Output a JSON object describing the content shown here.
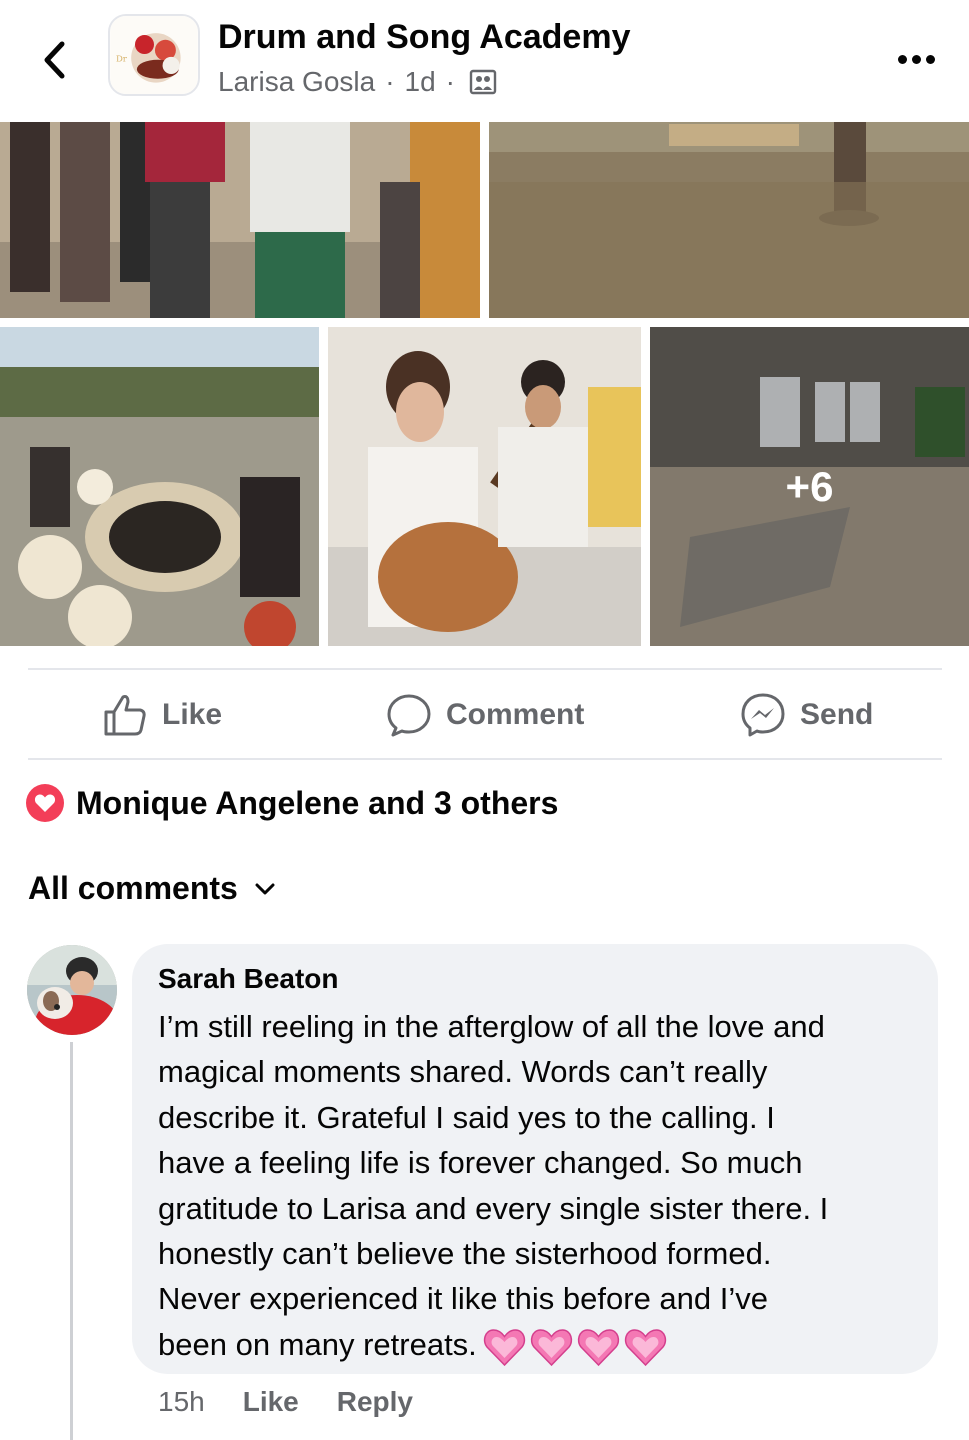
{
  "header": {
    "page_name": "Drum and Song Academy",
    "author": "Larisa Gosla",
    "separator": "·",
    "time": "1d",
    "back_icon": "chevron-left-icon",
    "audience_icon": "group-icon",
    "more_icon": "more-horizontal-icon"
  },
  "photos": {
    "items": [
      {
        "description_icon": "photo"
      },
      {
        "description_icon": "photo"
      },
      {
        "description_icon": "photo"
      },
      {
        "description_icon": "photo"
      },
      {
        "description_icon": "photo"
      }
    ],
    "more_count": "+6"
  },
  "actions": {
    "like": "Like",
    "comment": "Comment",
    "send": "Send"
  },
  "reactions": {
    "summary": "Monique Angelene and 3 others",
    "icon": "heart-reaction-icon"
  },
  "comments_filter": {
    "label": "All comments"
  },
  "comment": {
    "author": "Sarah Beaton",
    "lines": [
      "I’m still reeling in the afterglow of all the love and",
      "magical moments shared. Words can’t really",
      "describe it. Grateful I said yes to the calling. I",
      "have a feeling life is forever changed. So much",
      "gratitude to Larisa and every single sister there. I",
      "honestly can’t believe the sisterhood formed.",
      "Never experienced it like this before and I’ve",
      "been on many retreats."
    ],
    "emoji": "💗💗💗💗",
    "time": "15h",
    "like": "Like",
    "reply": "Reply"
  },
  "colors": {
    "primary_text": "#050505",
    "secondary_text": "#65676b",
    "bubble": "#f0f2f5",
    "divider": "#e4e6eb",
    "heart": "#f33e58"
  }
}
